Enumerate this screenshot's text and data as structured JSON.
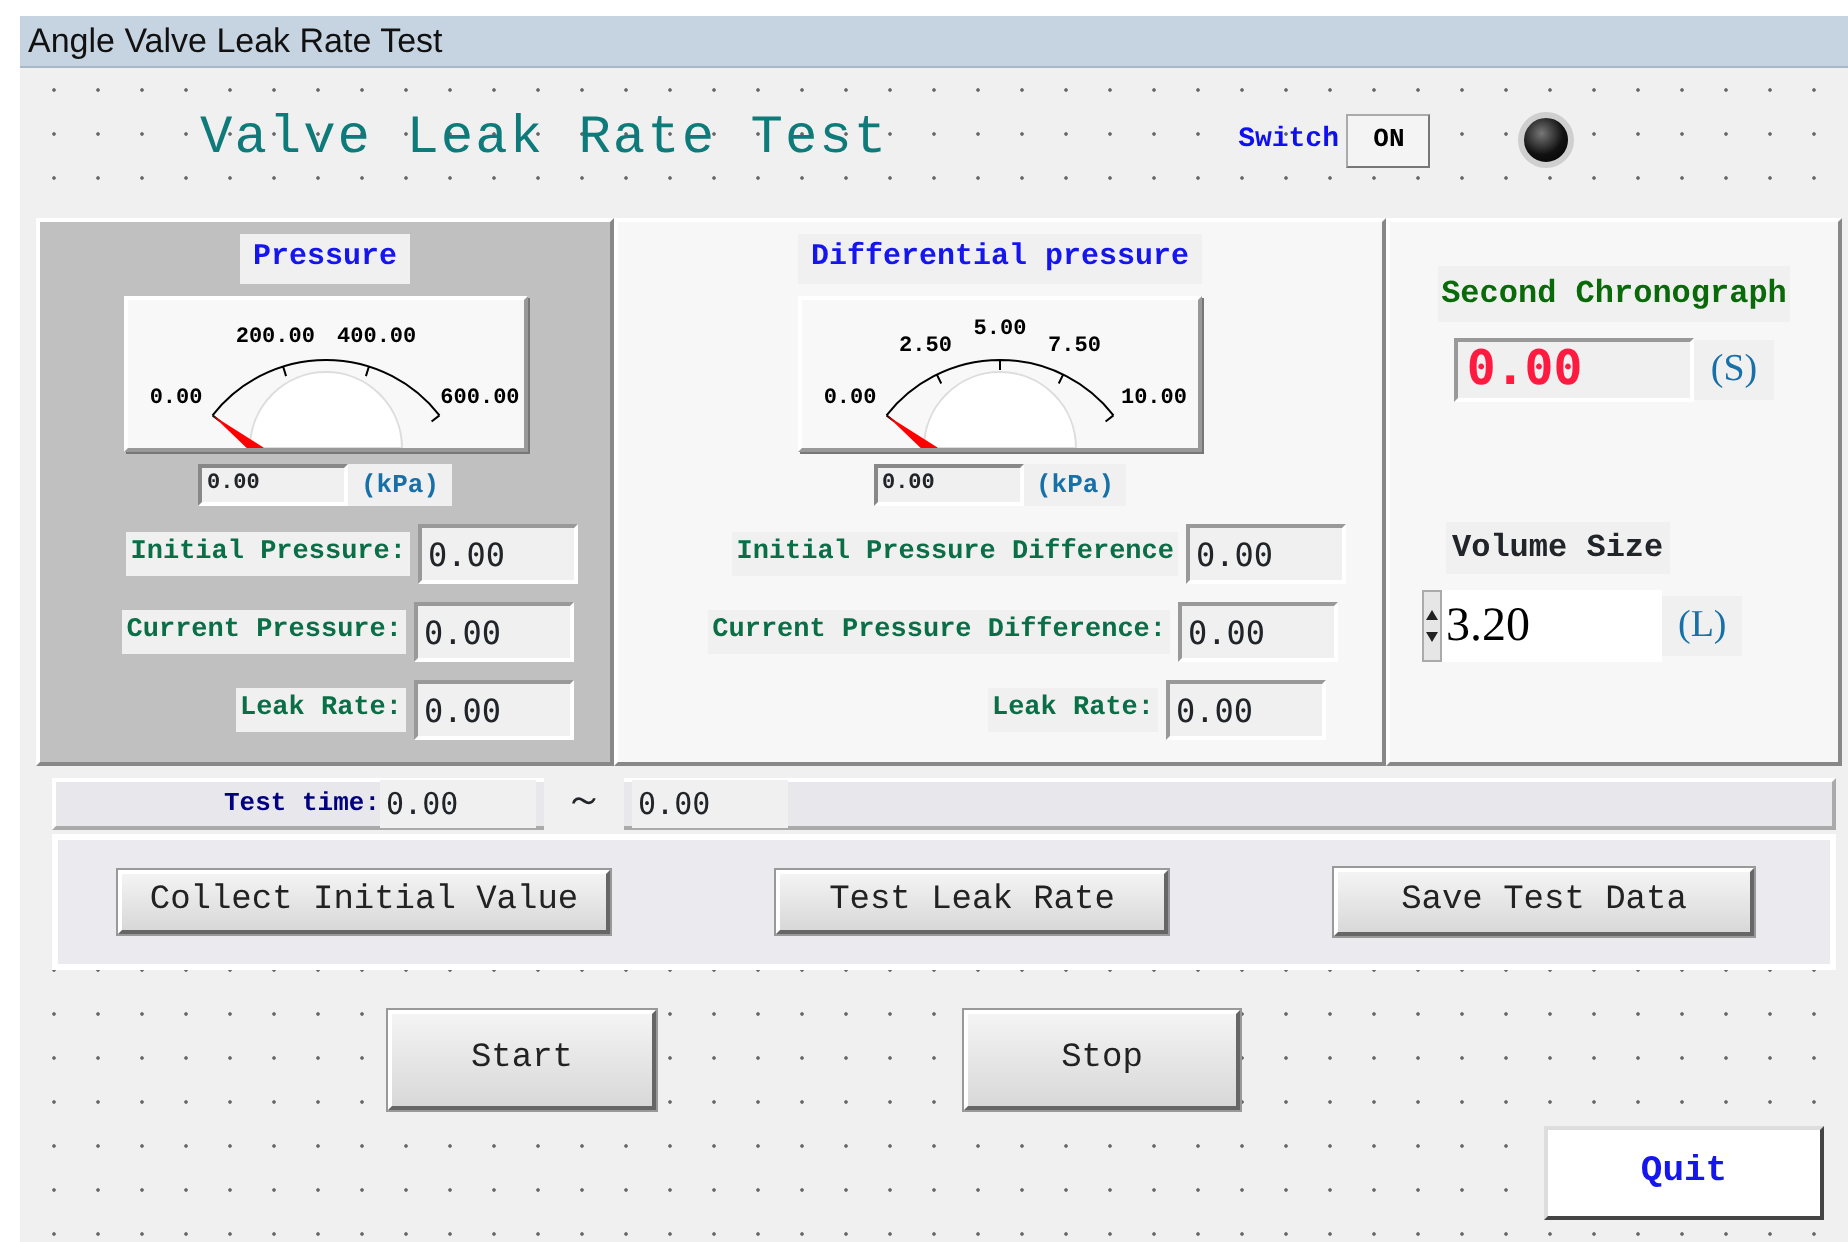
{
  "window": {
    "title": "Angle Valve Leak Rate Test"
  },
  "header": {
    "title": "Valve Leak Rate Test",
    "switch_label": "Switch",
    "switch_button": "ON",
    "indicator_on": false
  },
  "pressure_panel": {
    "title": "Pressure",
    "gauge": {
      "tick_labels": [
        "0.00",
        "200.00",
        "400.00",
        "600.00"
      ]
    },
    "reading": "0.00",
    "unit": "(kPa)",
    "fields": [
      {
        "label": "Initial Pressure:",
        "value": "0.00"
      },
      {
        "label": "Current Pressure:",
        "value": "0.00"
      },
      {
        "label": "Leak Rate:",
        "value": "0.00"
      }
    ]
  },
  "differential_panel": {
    "title": "Differential pressure",
    "gauge": {
      "tick_labels": [
        "0.00",
        "2.50",
        "5.00",
        "7.50",
        "10.00"
      ]
    },
    "reading": "0.00",
    "unit": "(kPa)",
    "fields": [
      {
        "label": "Initial Pressure Difference",
        "value": "0.00"
      },
      {
        "label": "Current Pressure Difference:",
        "value": "0.00"
      },
      {
        "label": "Leak Rate:",
        "value": "0.00"
      }
    ]
  },
  "chronograph": {
    "title": "Second Chronograph",
    "value": "0.00",
    "unit": "(S)"
  },
  "volume": {
    "label": "Volume Size",
    "value": "3.20",
    "unit": "(L)"
  },
  "test_time": {
    "label": "Test time:",
    "start": "0.00",
    "separator": "～",
    "end": "0.00"
  },
  "actions": [
    "Collect Initial Value",
    "Test Leak Rate",
    "Save Test Data"
  ],
  "controls": [
    "Start",
    "Stop"
  ],
  "quit": "Quit"
}
